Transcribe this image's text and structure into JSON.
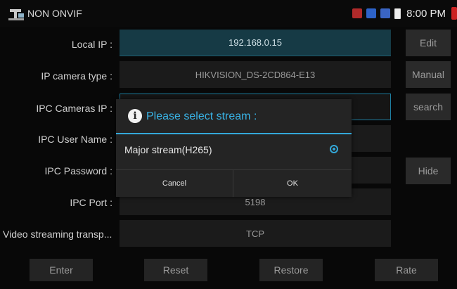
{
  "statusbar": {
    "app_title": "NON ONVIF",
    "clock": "8:00 PM",
    "icons": [
      "app-icon",
      "warning-icon",
      "download-icon",
      "blocked-icon",
      "battery-icon"
    ]
  },
  "form": {
    "local_ip": {
      "label": "Local IP :",
      "value": "192.168.0.15",
      "button": "Edit"
    },
    "camera_type": {
      "label": "IP camera type :",
      "value": "HIKVISION_DS-2CD864-E13",
      "button": "Manual"
    },
    "cameras_ip": {
      "label": "IPC Cameras IP :",
      "value": "",
      "button": "search"
    },
    "user_name": {
      "label": "IPC User Name :",
      "value": ""
    },
    "password": {
      "label": "IPC Password :",
      "value": "",
      "button": "Hide"
    },
    "port": {
      "label": "IPC Port :",
      "value": "5198"
    },
    "transport": {
      "label": "Video streaming transp...",
      "value": "TCP"
    }
  },
  "bottom_buttons": {
    "enter": "Enter",
    "reset": "Reset",
    "restore": "Restore",
    "rate": "Rate"
  },
  "dialog": {
    "title": "Please select stream :",
    "option": "Major stream(H265)",
    "option_selected": true,
    "cancel": "Cancel",
    "ok": "OK"
  },
  "colors": {
    "accent": "#33a8d9",
    "field_bg": "#1b1b1b",
    "active_field_bg": "#163a45"
  }
}
